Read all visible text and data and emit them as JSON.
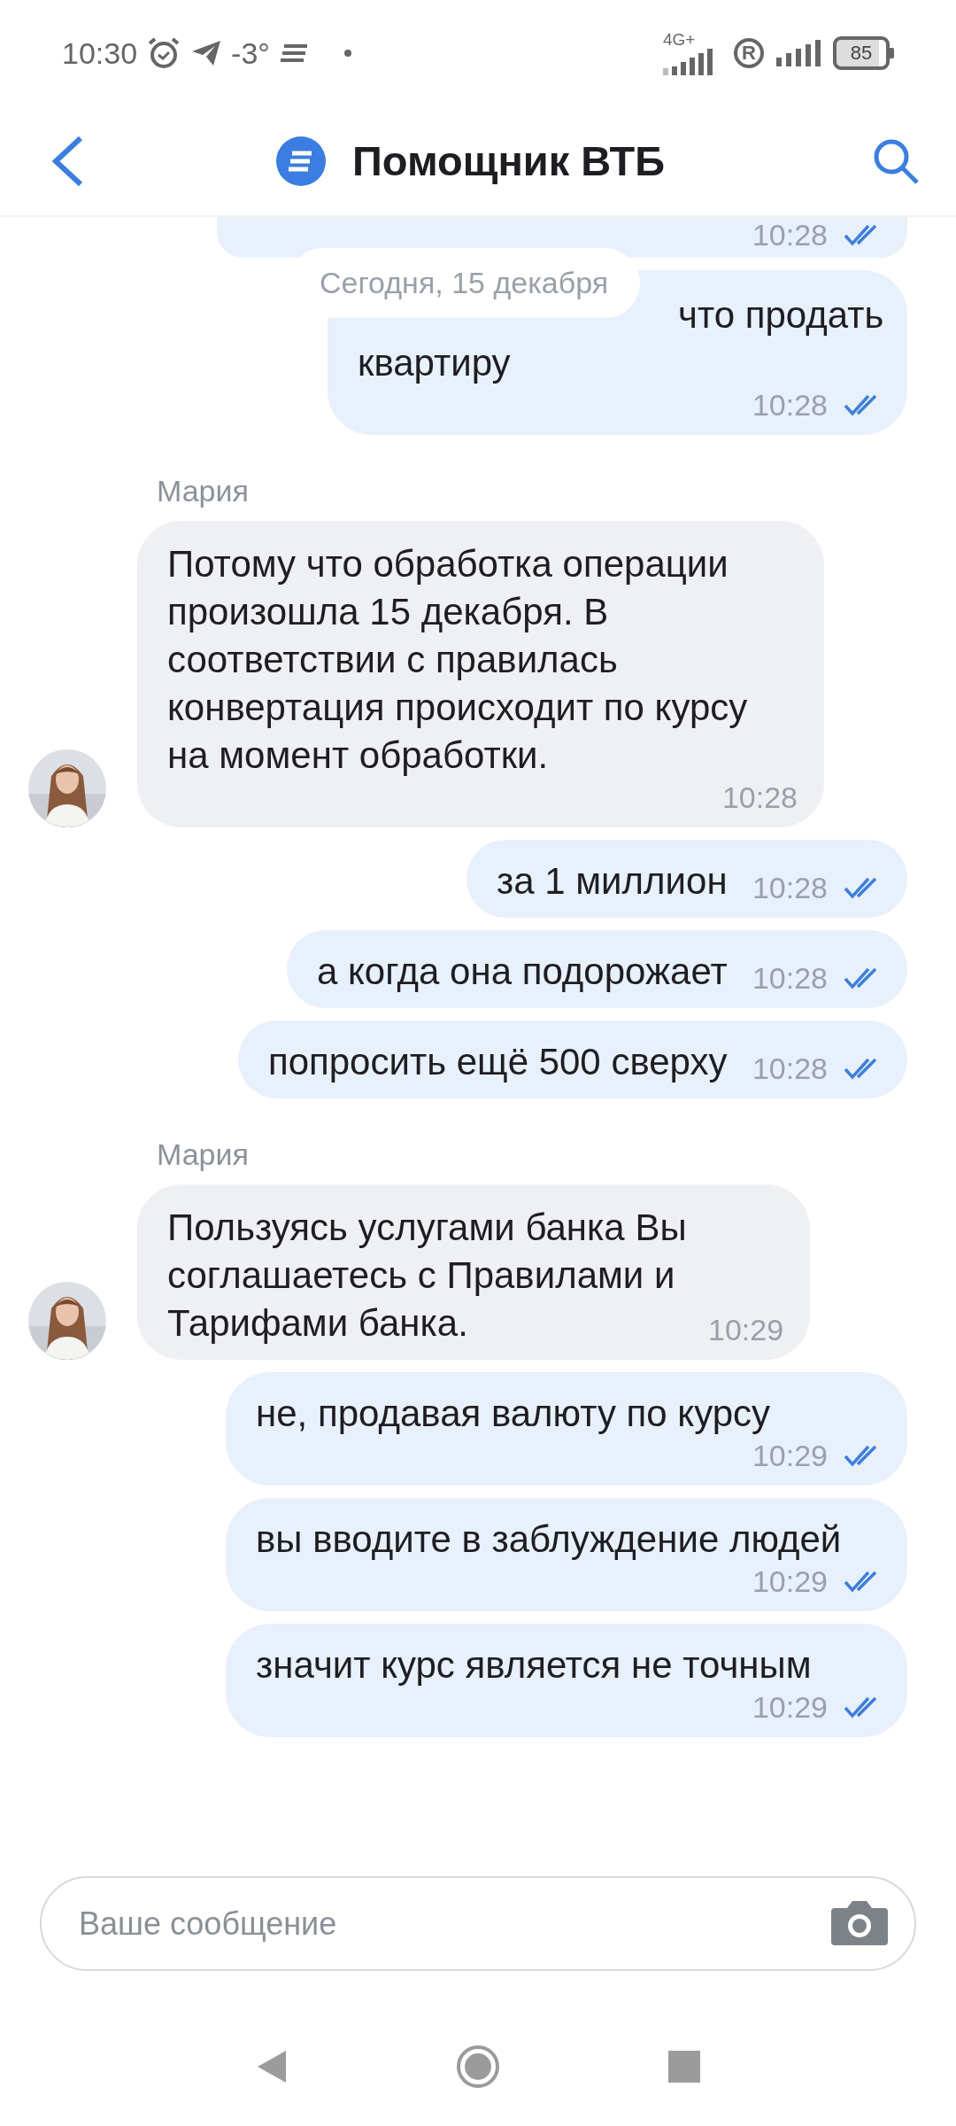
{
  "status_bar": {
    "time": "10:30",
    "temperature": "-3°",
    "network": "4G+",
    "roaming": "R",
    "battery": "85"
  },
  "header": {
    "title": "Помощник ВТБ"
  },
  "messages": [
    {
      "kind": "outgoing",
      "time": "10:28",
      "read": true
    },
    {
      "kind": "date",
      "text": "Сегодня, 15 декабря"
    },
    {
      "kind": "outgoing",
      "text": "что продать\nквартиру",
      "time": "10:28",
      "read": true
    },
    {
      "kind": "incoming",
      "sender": "Мария",
      "text": "Потому что обработка операции произошла 15 декабря. В соответствии с правилась конвертация происходит по курсу на момент обработки.",
      "time": "10:28"
    },
    {
      "kind": "outgoing",
      "text": "за 1 миллион",
      "time": "10:28",
      "read": true
    },
    {
      "kind": "outgoing",
      "text": "а когда она подорожает",
      "time": "10:28",
      "read": true
    },
    {
      "kind": "outgoing",
      "text": "попросить ещё 500 сверху",
      "time": "10:28",
      "read": true
    },
    {
      "kind": "incoming",
      "sender": "Мария",
      "text": "Пользуясь услугами банка Вы соглашаетесь с Правилами и Тарифами банка.",
      "time": "10:29"
    },
    {
      "kind": "outgoing",
      "text": "не, продавая валюту по курсу",
      "time": "10:29",
      "read": true
    },
    {
      "kind": "outgoing",
      "text": "вы вводите в заблуждение людей",
      "time": "10:29",
      "read": true
    },
    {
      "kind": "outgoing",
      "text": "значит курс является не точным",
      "time": "10:29",
      "read": true
    }
  ],
  "composer": {
    "placeholder": "Ваше сообщение"
  }
}
